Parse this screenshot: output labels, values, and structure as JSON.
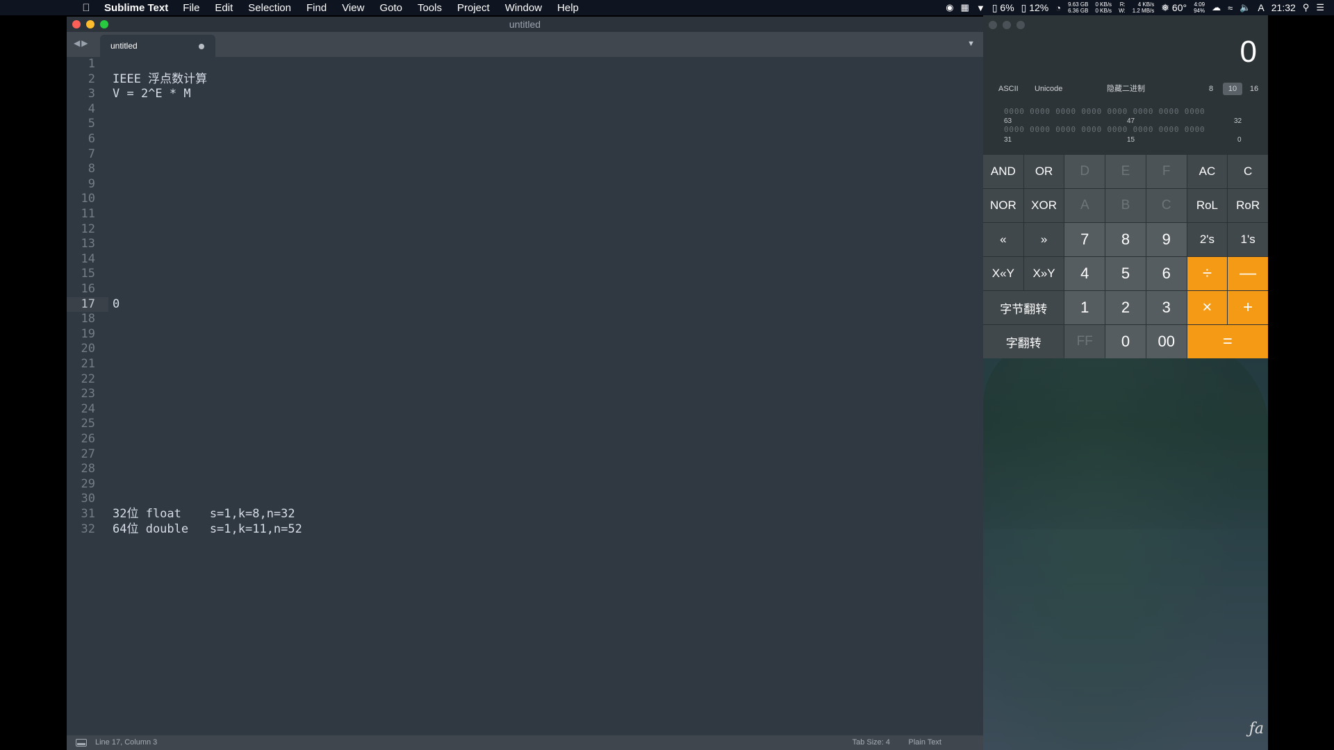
{
  "menubar": {
    "app_name": "Sublime Text",
    "items": [
      "File",
      "Edit",
      "Selection",
      "Find",
      "View",
      "Goto",
      "Tools",
      "Project",
      "Window",
      "Help"
    ],
    "status": {
      "battery_small": "6%",
      "cpu": "12%",
      "mem_top": "9.63 GB",
      "mem_bottom": "6.36 GB",
      "net_up": "0 KB/s",
      "net_down": "0 KB/s",
      "disk_read_label": "R:",
      "disk_write_label": "W:",
      "disk_read": "4 KB/s",
      "disk_write": "1.2 MB/s",
      "temperature": "60°",
      "battery_time": "4:09",
      "battery_percent": "94%",
      "input_method": "A",
      "clock": "21:32"
    }
  },
  "editor": {
    "window_title": "untitled",
    "tab_label": "untitled",
    "line_numbers": [
      "1",
      "2",
      "3",
      "4",
      "5",
      "6",
      "7",
      "8",
      "9",
      "10",
      "11",
      "12",
      "13",
      "14",
      "15",
      "16",
      "17",
      "18",
      "19",
      "20",
      "21",
      "22",
      "23",
      "24",
      "25",
      "26",
      "27",
      "28",
      "29",
      "30",
      "31",
      "32"
    ],
    "lines": {
      "line2": "IEEE 浮点数计算",
      "line3": "V = 2^E * M",
      "line17": "0",
      "line31": "32位 float    s=1,k=8,n=32",
      "line32": "64位 double   s=1,k=11,n=52"
    },
    "status": {
      "position": "Line 17, Column 3",
      "tab_size": "Tab Size: 4",
      "syntax": "Plain Text"
    }
  },
  "calculator": {
    "display": "0",
    "modes": [
      "ASCII",
      "Unicode",
      "隐藏二进制"
    ],
    "bases": [
      "8",
      "10",
      "16"
    ],
    "selected_base": "10",
    "bits_row1": "0000 0000 0000 0000 0000 0000 0000 0000",
    "bits_row2": "0000 0000 0000 0000 0000 0000 0000 0000",
    "bit_labels_row1": [
      "63",
      "47",
      "32"
    ],
    "bit_labels_row2": [
      "31",
      "15",
      "0"
    ],
    "keys": {
      "and": "AND",
      "or": "OR",
      "d": "D",
      "e": "E",
      "f": "F",
      "ac": "AC",
      "c": "C",
      "nor": "NOR",
      "xor": "XOR",
      "a": "A",
      "b": "B",
      "c_hex": "C",
      "rol": "RoL",
      "ror": "RoR",
      "shl": "«",
      "shr": "»",
      "seven": "7",
      "eight": "8",
      "nine": "9",
      "twos": "2's",
      "ones": "1's",
      "xshly": "X«Y",
      "xshry": "X»Y",
      "four": "4",
      "five": "5",
      "six": "6",
      "divide": "÷",
      "minus": "—",
      "byte_flip": "字节翻转",
      "one": "1",
      "two": "2",
      "three": "3",
      "multiply": "×",
      "plus": "+",
      "word_flip": "字翻转",
      "ff": "FF",
      "zero": "0",
      "double_zero": "00",
      "equals": "="
    }
  },
  "colors": {
    "editor_bg": "#303841",
    "accent_orange": "#f59a14",
    "menubar_bg": "#0e1420"
  }
}
